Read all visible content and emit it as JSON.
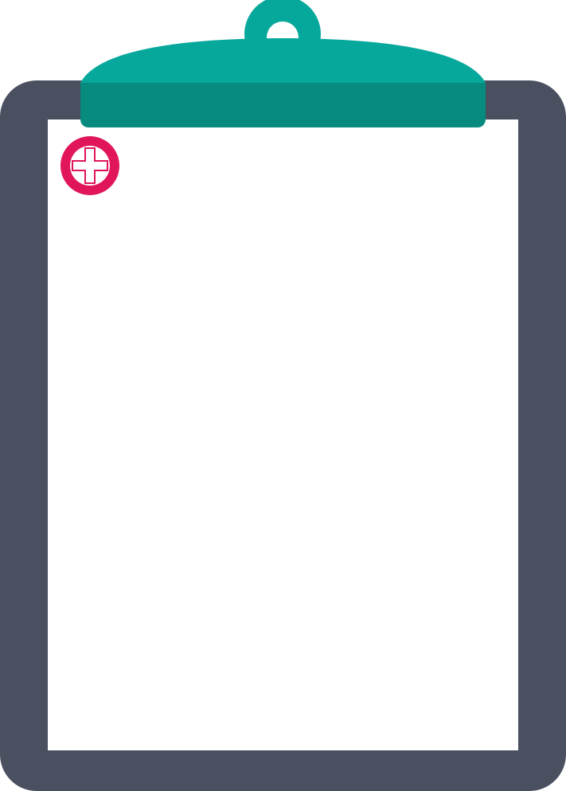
{
  "clipboard": {
    "colors": {
      "board": "#4a5060",
      "paper": "#ffffff",
      "clip_top": "#07a89c",
      "clip_bottom": "#078b7f",
      "badge": "#e0155a",
      "cross": "#ffffff"
    },
    "icons": {
      "clip": "clipboard-clip-icon",
      "badge": "medical-cross-icon"
    }
  }
}
